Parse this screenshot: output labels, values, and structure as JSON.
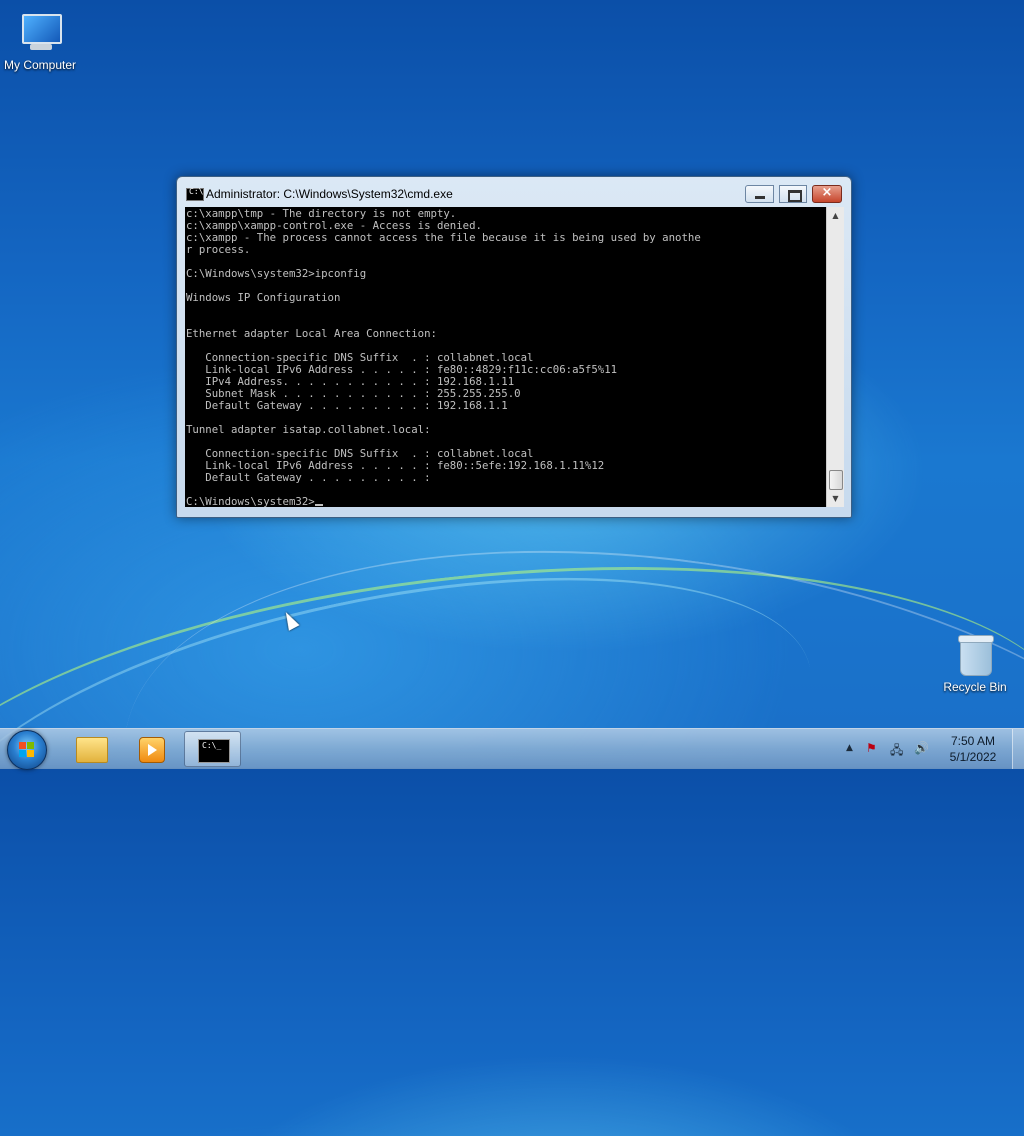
{
  "desktop": {
    "icons": [
      {
        "label": "My Computer",
        "icon": "computer-icon"
      },
      {
        "label": "Recycle Bin",
        "icon": "recycle-bin-icon"
      }
    ]
  },
  "window": {
    "title": "Administrator: C:\\Windows\\System32\\cmd.exe",
    "icon": "cmd-icon",
    "icon_text": "C:\\",
    "buttons": {
      "minimize": "minimize-icon",
      "maximize": "maximize-icon",
      "close": "×"
    }
  },
  "console": {
    "lines": [
      "c:\\xampp\\tmp - The directory is not empty.",
      "c:\\xampp\\xampp-control.exe - Access is denied.",
      "c:\\xampp - The process cannot access the file because it is being used by anothe",
      "r process.",
      "",
      "C:\\Windows\\system32>ipconfig",
      "",
      "Windows IP Configuration",
      "",
      "",
      "Ethernet adapter Local Area Connection:",
      "",
      "   Connection-specific DNS Suffix  . : collabnet.local",
      "   Link-local IPv6 Address . . . . . : fe80::4829:f11c:cc06:a5f5%11",
      "   IPv4 Address. . . . . . . . . . . : 192.168.1.11",
      "   Subnet Mask . . . . . . . . . . . : 255.255.255.0",
      "   Default Gateway . . . . . . . . . : 192.168.1.1",
      "",
      "Tunnel adapter isatap.collabnet.local:",
      "",
      "   Connection-specific DNS Suffix  . : collabnet.local",
      "   Link-local IPv6 Address . . . . . : fe80::5efe:192.168.1.11%12",
      "   Default Gateway . . . . . . . . . :",
      ""
    ],
    "prompt": "C:\\Windows\\system32>"
  },
  "taskbar": {
    "start": "start-orb-icon",
    "pinned": [
      {
        "name": "windows-explorer",
        "icon": "folder-icon"
      },
      {
        "name": "media-player",
        "icon": "media-player-icon"
      },
      {
        "name": "command-prompt",
        "icon": "cmd-icon",
        "icon_text": "C:\\_",
        "active": true
      }
    ],
    "tray": {
      "icons": [
        "show-hidden-icons-icon",
        "action-center-flag-icon",
        "network-icon",
        "volume-icon"
      ]
    },
    "clock": {
      "time": "7:50 AM",
      "date": "5/1/2022"
    }
  }
}
